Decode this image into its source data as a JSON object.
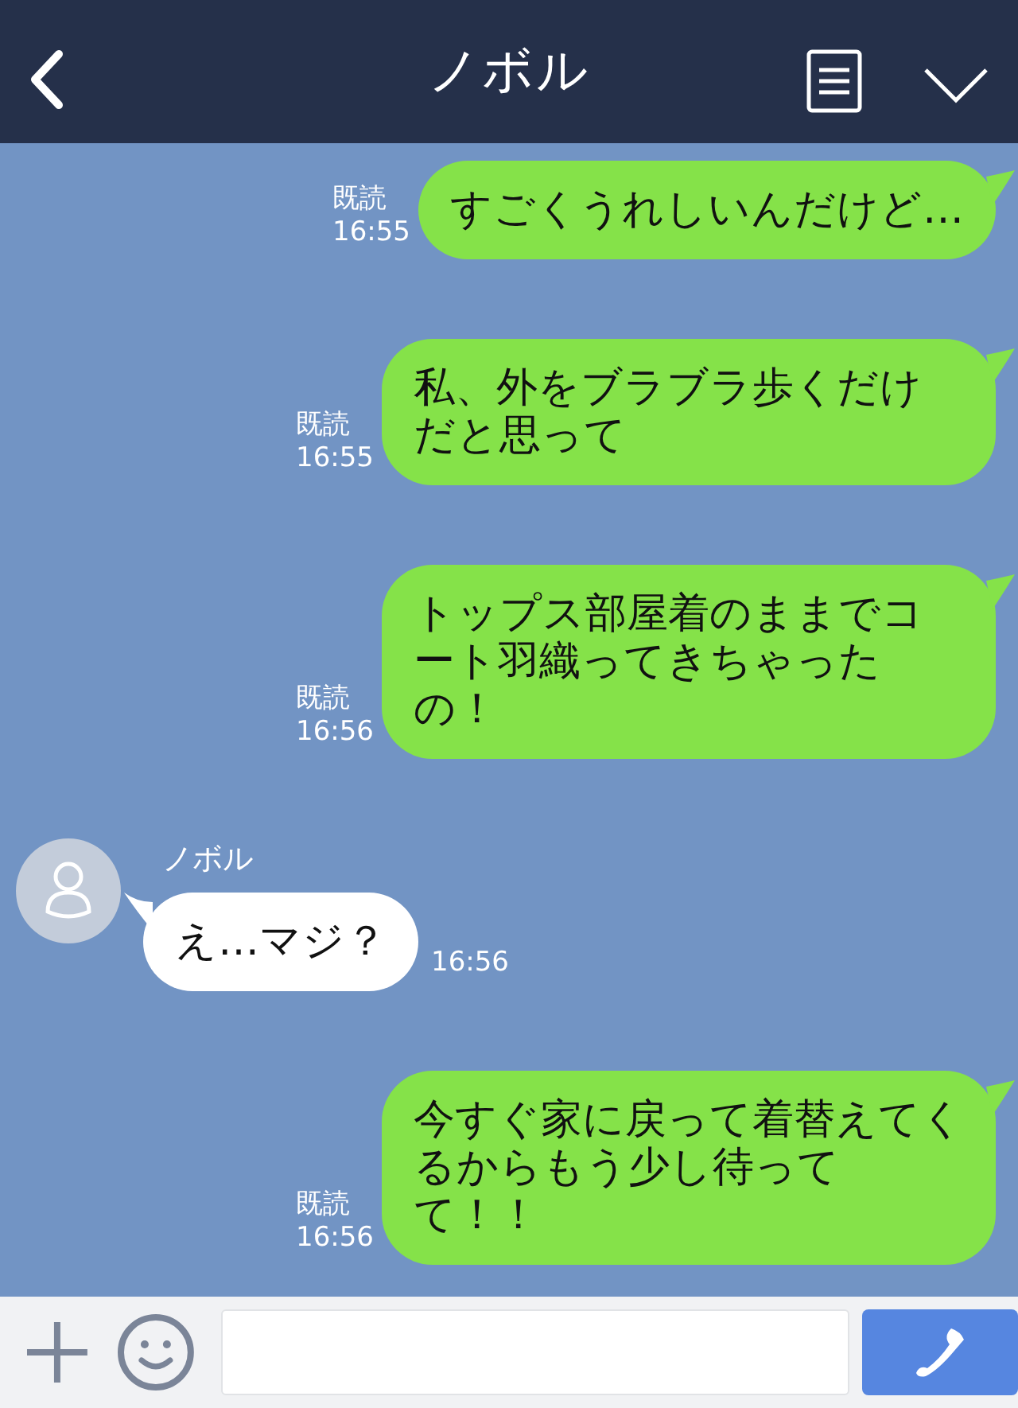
{
  "header": {
    "title": "ノボル"
  },
  "messages": [
    {
      "kind": "sent",
      "text": "すごくうれしいんだけど…",
      "read": "既読",
      "time": "16:55"
    },
    {
      "kind": "sent",
      "text": "私、外をブラブラ歩くだけだと思って",
      "read": "既読",
      "time": "16:55"
    },
    {
      "kind": "sent",
      "text": "トップス部屋着のままでコート羽織ってきちゃったの！",
      "read": "既読",
      "time": "16:56"
    },
    {
      "kind": "received",
      "sender": "ノボル",
      "text": "え…マジ？",
      "time": "16:56"
    },
    {
      "kind": "sent",
      "text": "今すぐ家に戻って着替えてくるからもう少し待ってて！！",
      "read": "既読",
      "time": "16:56"
    }
  ]
}
